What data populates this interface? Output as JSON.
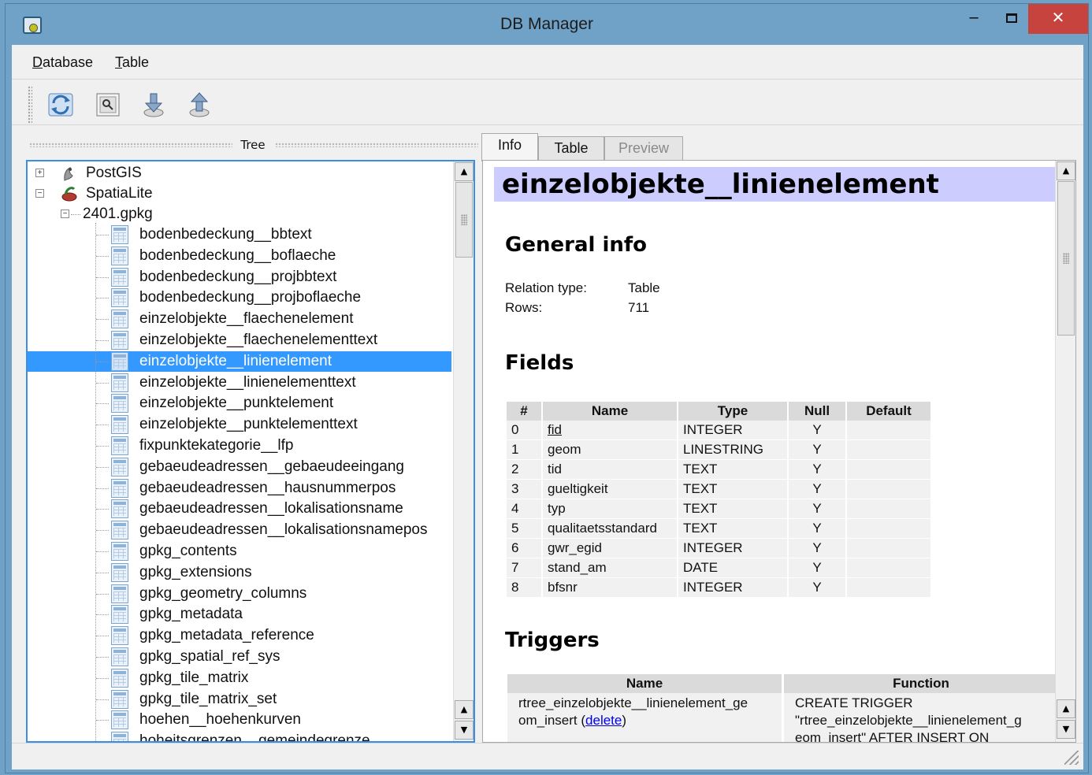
{
  "window": {
    "title": "DB Manager"
  },
  "menu": {
    "database": "Database",
    "table": "Table"
  },
  "toolbar": [
    "refresh-icon",
    "sql-window-icon",
    "import-layer-icon",
    "export-layer-icon"
  ],
  "tree": {
    "header": "Tree",
    "providers": [
      {
        "label": "PostGIS",
        "expanded": false
      },
      {
        "label": "SpatiaLite",
        "expanded": true
      }
    ],
    "database": "2401.gpkg",
    "tables": [
      "bodenbedeckung__bbtext",
      "bodenbedeckung__boflaeche",
      "bodenbedeckung__projbbtext",
      "bodenbedeckung__projboflaeche",
      "einzelobjekte__flaechenelement",
      "einzelobjekte__flaechenelementtext",
      "einzelobjekte__linienelement",
      "einzelobjekte__linienelementtext",
      "einzelobjekte__punktelement",
      "einzelobjekte__punktelementtext",
      "fixpunktekategorie__lfp",
      "gebaeudeadressen__gebaeudeeingang",
      "gebaeudeadressen__hausnummerpos",
      "gebaeudeadressen__lokalisationsname",
      "gebaeudeadressen__lokalisationsnamepos",
      "gpkg_contents",
      "gpkg_extensions",
      "gpkg_geometry_columns",
      "gpkg_metadata",
      "gpkg_metadata_reference",
      "gpkg_spatial_ref_sys",
      "gpkg_tile_matrix",
      "gpkg_tile_matrix_set",
      "hoehen__hoehenkurven",
      "hoheitsgrenzen__gemeindegrenze"
    ],
    "selected": "einzelobjekte__linienelement"
  },
  "tabs": [
    "Info",
    "Table",
    "Preview"
  ],
  "info": {
    "title": "einzelobjekte__linienelement",
    "general_heading": "General info",
    "relation_type_label": "Relation type:",
    "relation_type": "Table",
    "rows_label": "Rows:",
    "rows": "711",
    "fields_heading": "Fields",
    "fields_columns": [
      "#",
      "Name",
      "Type",
      "Null",
      "Default"
    ],
    "fields": [
      {
        "num": "0",
        "name": "fid",
        "type": "INTEGER",
        "null": "Y",
        "default": ""
      },
      {
        "num": "1",
        "name": "geom",
        "type": "LINESTRING",
        "null": "Y",
        "default": ""
      },
      {
        "num": "2",
        "name": "tid",
        "type": "TEXT",
        "null": "Y",
        "default": ""
      },
      {
        "num": "3",
        "name": "gueltigkeit",
        "type": "TEXT",
        "null": "Y",
        "default": ""
      },
      {
        "num": "4",
        "name": "typ",
        "type": "TEXT",
        "null": "Y",
        "default": ""
      },
      {
        "num": "5",
        "name": "qualitaetsstandard",
        "type": "TEXT",
        "null": "Y",
        "default": ""
      },
      {
        "num": "6",
        "name": "gwr_egid",
        "type": "INTEGER",
        "null": "Y",
        "default": ""
      },
      {
        "num": "7",
        "name": "stand_am",
        "type": "DATE",
        "null": "Y",
        "default": ""
      },
      {
        "num": "8",
        "name": "bfsnr",
        "type": "INTEGER",
        "null": "Y",
        "default": ""
      }
    ],
    "triggers_heading": "Triggers",
    "triggers_columns": [
      "Name",
      "Function"
    ],
    "trigger": {
      "name_line1": "rtree_einzelobjekte__linienelement_ge",
      "name_line2": "om_insert",
      "delete_link": "delete",
      "function_line1": "CREATE TRIGGER",
      "function_line2": "\"rtree_einzelobjekte__linienelement_g",
      "function_line3": "eom_insert\" AFTER INSERT ON"
    }
  },
  "colors": {
    "titlebar": "#6fa2c6",
    "selection": "#3399ff",
    "info_title_bg": "#ccccff",
    "close_button": "#c7433d"
  }
}
